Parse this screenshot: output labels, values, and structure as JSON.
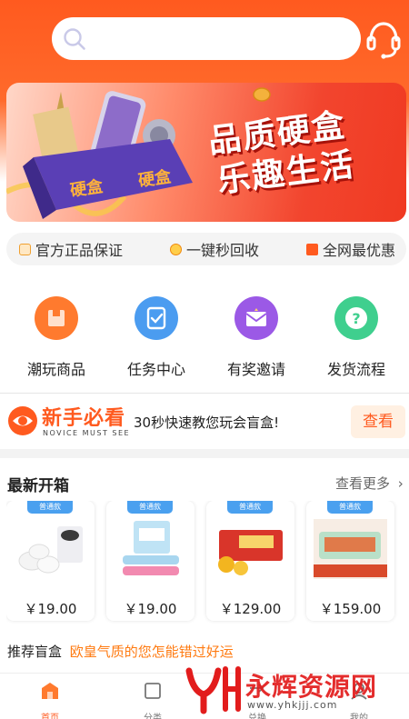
{
  "search": {
    "placeholder": ""
  },
  "banner": {
    "line1": "品质硬盒",
    "line2": "乐趣生活"
  },
  "guarantees": [
    {
      "label": "官方正品保证",
      "icon": "certificate-icon"
    },
    {
      "label": "一键秒回收",
      "icon": "recycle-coin-icon"
    },
    {
      "label": "全网最优惠",
      "icon": "discount-tag-icon"
    }
  ],
  "shortcuts": [
    {
      "label": "潮玩商品",
      "icon": "box-icon",
      "color": "#ff7a2e"
    },
    {
      "label": "任务中心",
      "icon": "task-icon",
      "color": "#4b9cf0"
    },
    {
      "label": "有奖邀请",
      "icon": "invite-icon",
      "color": "#9b59e6"
    },
    {
      "label": "发货流程",
      "icon": "help-icon",
      "color": "#3fcf8e"
    }
  ],
  "novice": {
    "title": "新手必看",
    "subtitle": "NOVICE MUST SEE",
    "description": "30秒快速教您玩会盲盒!",
    "button": "查看"
  },
  "latest": {
    "title": "最新开箱",
    "more": "查看更多",
    "products": [
      {
        "tag": "普通款",
        "price": "￥19.00"
      },
      {
        "tag": "普通款",
        "price": "￥19.00"
      },
      {
        "tag": "普通款",
        "price": "￥129.00"
      },
      {
        "tag": "普通款",
        "price": "￥159.00"
      }
    ]
  },
  "recommend": {
    "title": "推荐盲盒",
    "subtitle": "欧皇气质的您怎能错过好运"
  },
  "nav": [
    {
      "label": "首页",
      "active": true
    },
    {
      "label": "分类",
      "active": false
    },
    {
      "label": "兑换",
      "active": false
    },
    {
      "label": "我的",
      "active": false
    }
  ],
  "watermark": {
    "text": "永辉资源网",
    "url": "www.yhkjjj.com"
  },
  "colors": {
    "brand": "#ff5a1f",
    "accent_orange": "#ff7a10",
    "tag_blue": "#4aa0ef"
  }
}
